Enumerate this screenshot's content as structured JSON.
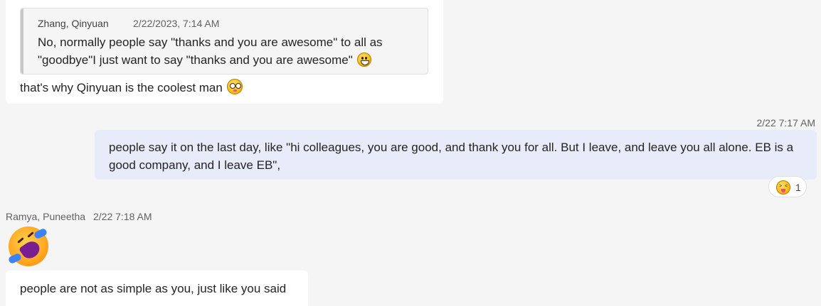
{
  "messages": {
    "first": {
      "quote": {
        "author": "Zhang, Qinyuan",
        "time": "2/22/2023, 7:14 AM",
        "text": "No, normally people say \"thanks and you are awesome\" to all as \"goodbye\"I just want to say \"thanks and you are awesome\"",
        "emoji": "grinning-face-icon"
      },
      "text": "that's why Qinyuan is the coolest man",
      "emoji": "zany-face-icon"
    },
    "second": {
      "time": "2/22 7:17 AM",
      "text": "people say it on the last day, like \"hi colleagues, you are good, and thank you for all. But I leave, and leave you all alone. EB is a good company, and I leave EB\",",
      "reaction": {
        "emoji": "squinting-tongue-face-icon",
        "count": "1"
      }
    },
    "third": {
      "sender": "Ramya, Puneetha",
      "time": "2/22 7:18 AM",
      "emoji": "rolling-on-floor-laughing-icon",
      "text": "people are not as simple as you, just like you said"
    }
  },
  "colors": {
    "background": "#f5f5f5",
    "incoming_bubble": "#ffffff",
    "outgoing_bubble": "#e8ebfa"
  }
}
